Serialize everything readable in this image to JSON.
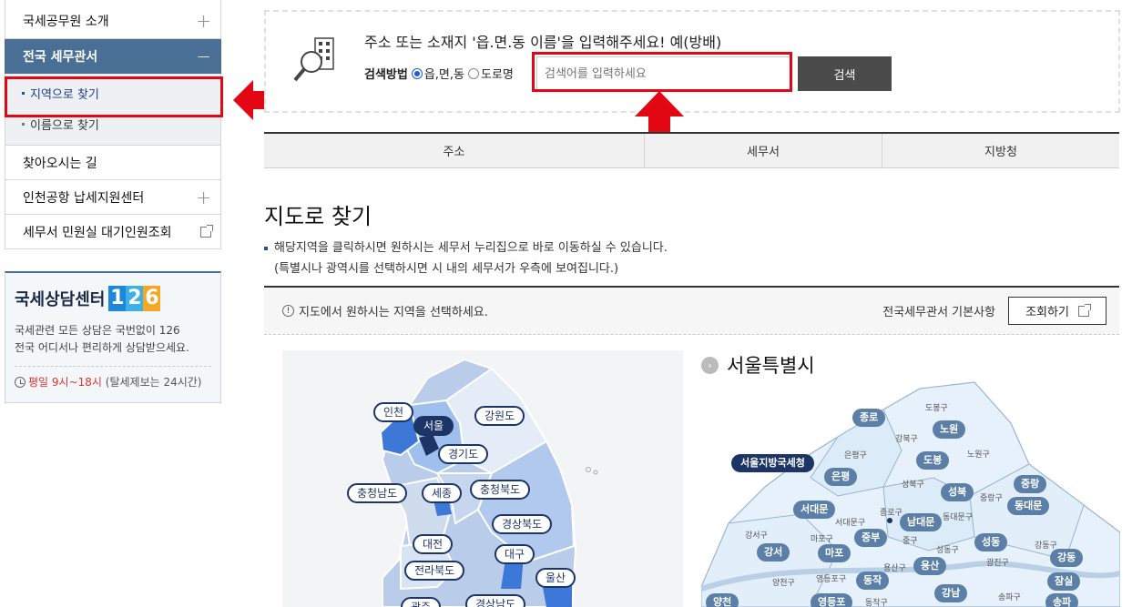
{
  "sidebar": {
    "items": [
      {
        "label": "국세공무원 소개",
        "toggle": "+"
      },
      {
        "label": "전국 세무관서",
        "toggle": "−"
      }
    ],
    "subitems": [
      {
        "label": "지역으로 찾기"
      },
      {
        "label": "이름으로 찾기"
      }
    ],
    "items2": [
      {
        "label": "찾아오시는 길"
      },
      {
        "label": "인천공항 납세지원센터",
        "toggle": "+"
      },
      {
        "label": "세무서 민원실 대기인원조회"
      }
    ]
  },
  "call_center": {
    "title": "국세상담센터",
    "number": [
      "1",
      "2",
      "6"
    ],
    "number_colors": [
      "#1e88d8",
      "#3db0e8",
      "#f5a623"
    ],
    "desc_line1": "국세관련 모든 상담은 국번없이 126",
    "desc_line2": "전국 어디서나 편리하게 상담받으세요.",
    "hours_red": "평일 9시~18시",
    "hours_rest": "(탈세제보는 24시간)"
  },
  "search": {
    "title": "주소 또는 소재지 '읍.면.동 이름'을 입력해주세요! 예(방배)",
    "method_label": "검색방법",
    "option1": "읍,면,동",
    "option2": "도로명",
    "placeholder": "검색어를 입력하세요",
    "button": "검색"
  },
  "tabs": [
    "주소",
    "세무서",
    "지방청"
  ],
  "page_title": "지도로 찾기",
  "info": {
    "line1": "해당지역을 클릭하시면 원하시는 세무서 누리집으로 바로 이동하실 수 있습니다.",
    "line2": "(특별시나 광역시를 선택하시면 시 내의 세무서가 우측에 보여집니다.)"
  },
  "bar": {
    "notice": "지도에서 원하시는 지역을 선택하세요.",
    "basics": "전국세무관서 기본사항",
    "view_button": "조회하기"
  },
  "korea_map": {
    "regions": [
      "인천",
      "서울",
      "강원도",
      "경기도",
      "충청남도",
      "세종",
      "충청북도",
      "경상북도",
      "대전",
      "대구",
      "전라북도",
      "울산",
      "광주",
      "경상남도"
    ]
  },
  "seoul": {
    "title": "서울특별시",
    "offices": [
      "종로",
      "노원",
      "도봉",
      "은평",
      "성북",
      "중랑",
      "동대문",
      "서대문",
      "남대문",
      "종로",
      "중부",
      "마포",
      "성동",
      "강서",
      "강동",
      "용산",
      "동작",
      "잠실",
      "양천",
      "영등포",
      "강남",
      "송파"
    ],
    "hq": "서울지방국세청",
    "gu": [
      "도봉구",
      "강북구",
      "노원구",
      "은평구",
      "성북구",
      "중랑구",
      "동대문구",
      "종로구",
      "서대문구",
      "중구",
      "강서구",
      "마포구",
      "성동구",
      "광진구",
      "강동구",
      "용산구",
      "양천구",
      "영등포구",
      "동작구",
      "송파구"
    ]
  }
}
